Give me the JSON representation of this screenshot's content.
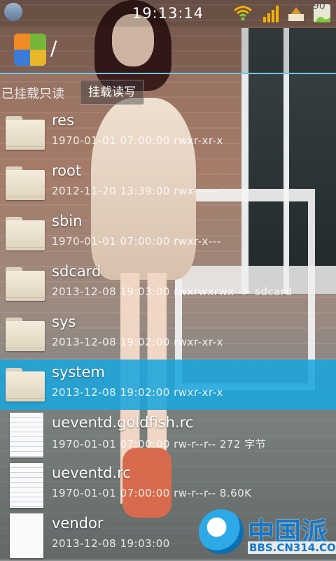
{
  "status_bar": {
    "time": "19:13:14",
    "battery_level": "90",
    "icons": [
      "app-notification-icon",
      "wifi-icon",
      "signal-icon",
      "notification-icon",
      "battery-icon"
    ]
  },
  "header": {
    "path": "/",
    "app_icon": "file-manager-icon"
  },
  "mount": {
    "read_only_label": "已挂载只读",
    "read_write_button": "挂载读写"
  },
  "files": [
    {
      "name": "res",
      "meta": "1970-01-01 07:00:00  rwxr-xr-x",
      "type": "folder",
      "selected": false
    },
    {
      "name": "root",
      "meta": "2012-11-20 13:39:00  rwx------",
      "type": "folder",
      "selected": false
    },
    {
      "name": "sbin",
      "meta": "1970-01-01 07:00:00  rwxr-x---",
      "type": "folder",
      "selected": false
    },
    {
      "name": "sdcard",
      "meta": "2013-12-08 19:03:00  rwxrwxrwx -> sdcard",
      "type": "folder",
      "selected": false
    },
    {
      "name": "sys",
      "meta": "2013-12-08 19:02:00  rwxr-xr-x",
      "type": "folder",
      "selected": false
    },
    {
      "name": "system",
      "meta": "2013-12-08 19:02:00  rwxr-xr-x",
      "type": "folder",
      "selected": true
    },
    {
      "name": "ueventd.goldfish.rc",
      "meta": "1970-01-01 07:00:00  rw-r--r--  272 字节",
      "type": "file",
      "selected": false
    },
    {
      "name": "ueventd.rc",
      "meta": "1970-01-01 07:00:00  rw-r--r--  8.60K",
      "type": "file",
      "selected": false
    },
    {
      "name": "vendor",
      "meta": "2013-12-08 19:03:00",
      "type": "file-plain",
      "selected": false
    }
  ],
  "watermark": {
    "brand": "中国派",
    "url": "BBS.CN314.COM"
  },
  "colors": {
    "selection": "#1aa5dc",
    "path_underline": "#6fc6ea"
  }
}
